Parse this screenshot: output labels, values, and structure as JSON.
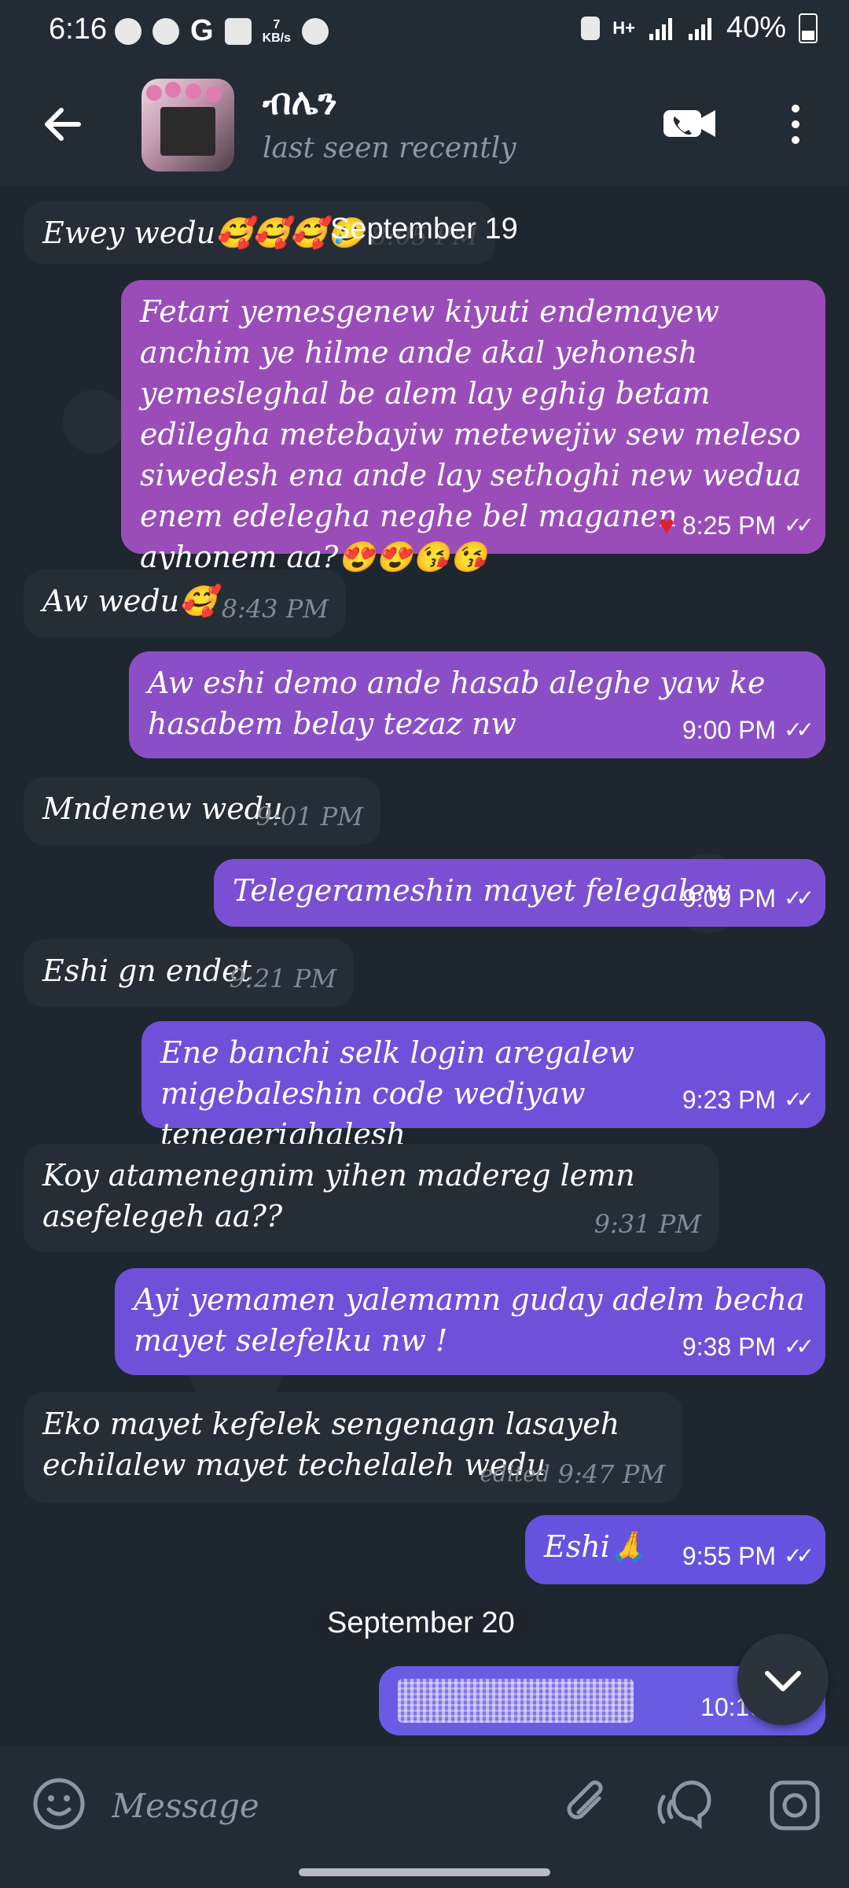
{
  "status_bar": {
    "time": "6:16",
    "speed_value": "7",
    "speed_unit": "KB/s",
    "network": "H+",
    "battery": "40%"
  },
  "header": {
    "name": "ብሌን",
    "status": "last seen recently"
  },
  "messages": [
    {
      "dir": "in",
      "text": "Ewey wedu🥰🥰🥰🥲",
      "time": "8:05 PM"
    },
    {
      "dir": "out",
      "text": "Fetari yemesgenew kiyuti endemayew anchim ye hilme ande akal yehonesh yemesleghal be alem lay eghig betam edilegha metebayiw metewejiw sew meleso siwedesh ena ande lay sethoghi new wedua enem edelegha neghe bel maganen ayhonem aa?😍😍😘😘",
      "time": "8:25 PM",
      "reaction": "♥"
    },
    {
      "dir": "in",
      "text": "Aw wedu🥰",
      "time": "8:43 PM"
    },
    {
      "dir": "out",
      "text": "Aw eshi demo ande hasab aleghe yaw ke hasabem belay tezaz nw",
      "time": "9:00 PM"
    },
    {
      "dir": "in",
      "text": "Mndenew wedu",
      "time": "9:01 PM"
    },
    {
      "dir": "out",
      "text": "Telegerameshin mayet felegalew",
      "time": "9:09 PM"
    },
    {
      "dir": "in",
      "text": "Eshi gn endet",
      "time": "9:21 PM"
    },
    {
      "dir": "out",
      "text": "Ene banchi selk login aregalew migebaleshin code wediyaw tenegerighalesh",
      "time": "9:23 PM"
    },
    {
      "dir": "in",
      "text": "Koy atamenegnim yihen madereg lemn asefelegeh aa??",
      "time": "9:31 PM"
    },
    {
      "dir": "out",
      "text": "Ayi yemamen yalemamn guday adelm becha mayet selefelku nw !",
      "time": "9:38 PM"
    },
    {
      "dir": "in",
      "text": "Eko mayet kefelek sengenagn lasayeh echilalew mayet techelaleh wedu",
      "time": "9:47 PM",
      "edited": "edited"
    },
    {
      "dir": "out",
      "text": "Eshi🙏",
      "time": "9:55 PM"
    },
    {
      "dir": "out",
      "text": "",
      "time": "10:10 PM",
      "hidden": true
    }
  ],
  "dates": {
    "sep19": "September 19",
    "sep20": "September 20"
  },
  "ticks": "✓✓",
  "input": {
    "placeholder": "Message"
  }
}
